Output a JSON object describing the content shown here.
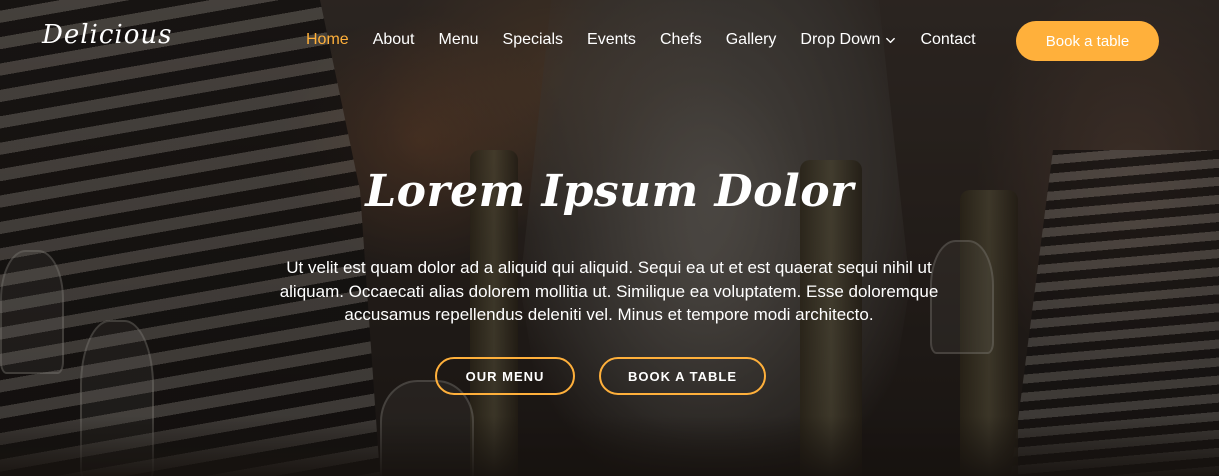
{
  "brand": {
    "logo_text": "Delicious"
  },
  "nav": {
    "items": [
      {
        "label": "Home",
        "active": true
      },
      {
        "label": "About"
      },
      {
        "label": "Menu"
      },
      {
        "label": "Specials"
      },
      {
        "label": "Events"
      },
      {
        "label": "Chefs"
      },
      {
        "label": "Gallery"
      },
      {
        "label": "Drop Down",
        "icon": "chevron-down-icon"
      },
      {
        "label": "Contact"
      }
    ],
    "book_button_label": "Book a table"
  },
  "hero": {
    "title": "Lorem Ipsum Dolor",
    "description": "Ut velit est quam dolor ad a aliquid qui aliquid. Sequi ea ut et est quaerat sequi nihil ut aliquam. Occaecati alias dolorem mollitia ut. Similique ea voluptatem. Esse doloremque accusamus repellendus deleniti vel. Minus et tempore modi architecto.",
    "buttons": {
      "menu": "OUR MENU",
      "book": "BOOK A TABLE"
    }
  },
  "colors": {
    "accent": "#ffb03b",
    "text": "#ffffff"
  }
}
